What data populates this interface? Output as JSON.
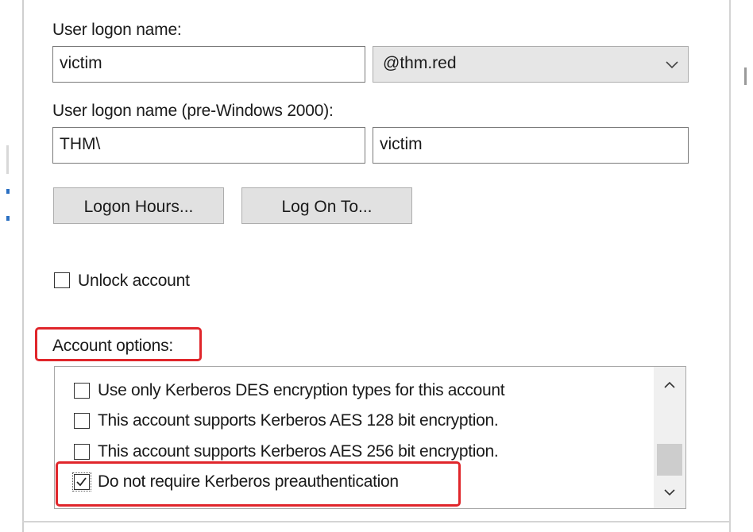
{
  "logon": {
    "label": "User logon name:",
    "name_value": "victim",
    "domain_value": "@thm.red"
  },
  "prewin": {
    "label": "User logon name (pre-Windows 2000):",
    "domain_value": "THM\\",
    "name_value": "victim"
  },
  "buttons": {
    "logon_hours": "Logon Hours...",
    "log_on_to": "Log On To..."
  },
  "unlock": {
    "label": "Unlock account",
    "checked": false
  },
  "account_options": {
    "label": "Account options:",
    "items": [
      {
        "label": "Use only Kerberos DES encryption types for this account",
        "checked": false
      },
      {
        "label": "This account supports Kerberos AES 128 bit encryption.",
        "checked": false
      },
      {
        "label": "This account supports Kerberos AES 256 bit encryption.",
        "checked": false
      },
      {
        "label": "Do not require Kerberos preauthentication",
        "checked": true
      }
    ]
  },
  "icons": {
    "dropdown": "chevron-down-icon",
    "checkmark": "checkmark-icon",
    "scroll_up": "scroll-up-icon",
    "scroll_down": "scroll-down-icon"
  },
  "colors": {
    "highlight": "#e0262b",
    "button_bg": "#e1e1e1",
    "combo_bg": "#e6e6e6"
  }
}
